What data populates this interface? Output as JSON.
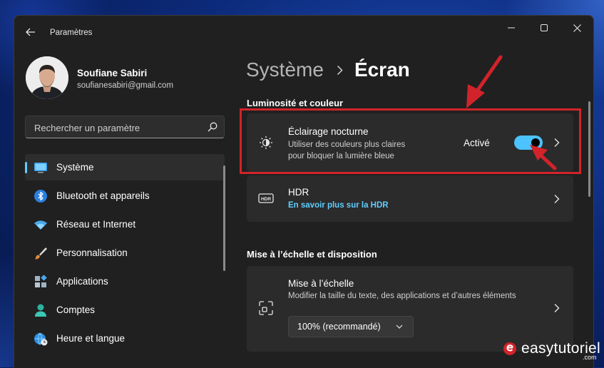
{
  "window": {
    "title": "Paramètres"
  },
  "user": {
    "name": "Soufiane Sabiri",
    "email": "soufianesabiri@gmail.com"
  },
  "search": {
    "placeholder": "Rechercher un paramètre"
  },
  "nav": {
    "items": [
      {
        "label": "Système",
        "icon": "monitor-icon",
        "active": true
      },
      {
        "label": "Bluetooth et appareils",
        "icon": "bluetooth-icon"
      },
      {
        "label": "Réseau et Internet",
        "icon": "wifi-icon"
      },
      {
        "label": "Personnalisation",
        "icon": "paintbrush-icon"
      },
      {
        "label": "Applications",
        "icon": "apps-icon"
      },
      {
        "label": "Comptes",
        "icon": "person-icon"
      },
      {
        "label": "Heure et langue",
        "icon": "globe-clock-icon"
      }
    ]
  },
  "breadcrumb": {
    "parent": "Système",
    "separator": "›",
    "current": "Écran"
  },
  "sections": {
    "brightness": {
      "title": "Luminosité et couleur",
      "night_light": {
        "title": "Éclairage nocturne",
        "desc_line1": "Utiliser des couleurs plus claires",
        "desc_line2": "pour bloquer la lumière bleue",
        "status": "Activé",
        "toggle_on": true
      },
      "hdr": {
        "title": "HDR",
        "link": "En savoir plus sur la HDR"
      }
    },
    "scale": {
      "title": "Mise à l’échelle et disposition",
      "scale_card": {
        "title": "Mise à l’échelle",
        "desc": "Modifier la taille du texte, des applications et d’autres éléments",
        "dropdown_value": "100% (recommandé)"
      }
    }
  },
  "colors": {
    "accent": "#4cc2ff",
    "highlight": "#d2232a",
    "link": "#60cdff"
  },
  "watermark": {
    "text": "easytutoriel",
    "suffix": ".com"
  }
}
